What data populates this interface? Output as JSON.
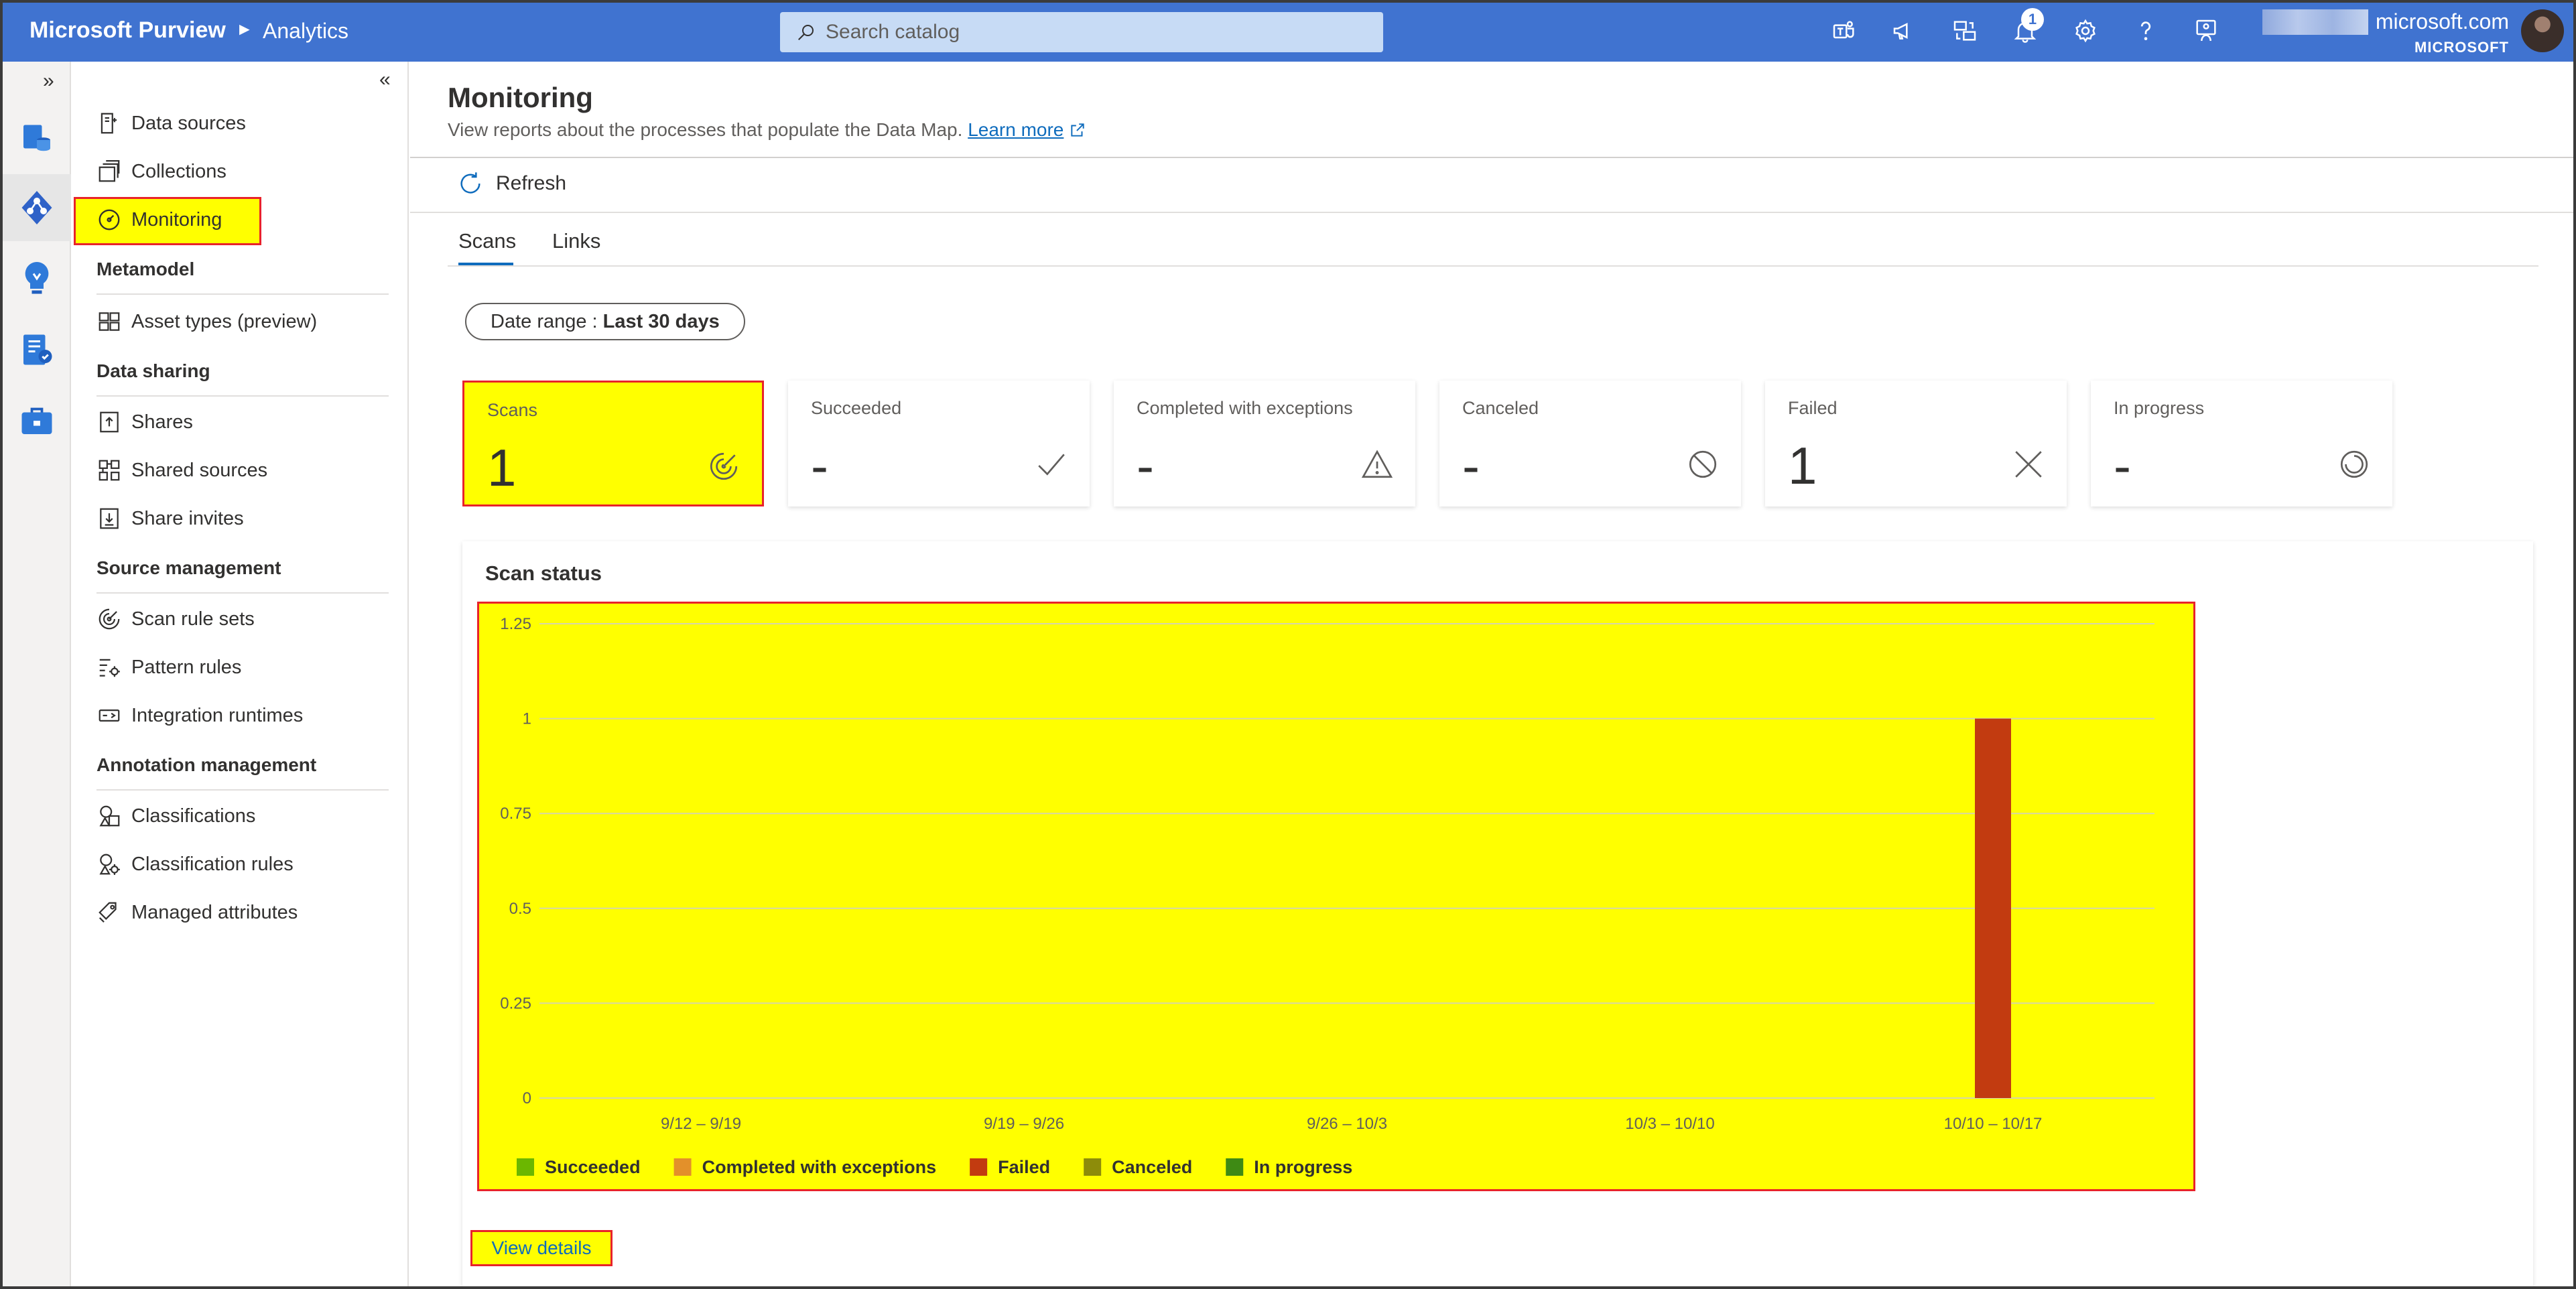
{
  "topbar": {
    "brand": "Microsoft Purview",
    "breadcrumb": "Analytics",
    "search_placeholder": "Search catalog",
    "notification_count": "1",
    "account_email": "microsoft.com",
    "account_org": "MICROSOFT"
  },
  "nav": {
    "items": [
      {
        "label": "Data sources",
        "icon": "data-sources-icon"
      },
      {
        "label": "Collections",
        "icon": "collections-icon"
      },
      {
        "label": "Monitoring",
        "icon": "monitoring-icon"
      }
    ],
    "sections": [
      {
        "title": "Metamodel",
        "items": [
          {
            "label": "Asset types (preview)",
            "icon": "asset-types-icon"
          }
        ]
      },
      {
        "title": "Data sharing",
        "items": [
          {
            "label": "Shares",
            "icon": "shares-icon"
          },
          {
            "label": "Shared sources",
            "icon": "shared-sources-icon"
          },
          {
            "label": "Share invites",
            "icon": "share-invites-icon"
          }
        ]
      },
      {
        "title": "Source management",
        "items": [
          {
            "label": "Scan rule sets",
            "icon": "scan-rule-sets-icon"
          },
          {
            "label": "Pattern rules",
            "icon": "pattern-rules-icon"
          },
          {
            "label": "Integration runtimes",
            "icon": "integration-runtimes-icon"
          }
        ]
      },
      {
        "title": "Annotation management",
        "items": [
          {
            "label": "Classifications",
            "icon": "classifications-icon"
          },
          {
            "label": "Classification rules",
            "icon": "classification-rules-icon"
          },
          {
            "label": "Managed attributes",
            "icon": "managed-attributes-icon"
          }
        ]
      }
    ]
  },
  "page": {
    "title": "Monitoring",
    "subtitle": "View reports about the processes that populate the Data Map.",
    "learn_more": "Learn more",
    "refresh": "Refresh",
    "tabs": [
      "Scans",
      "Links"
    ],
    "date_range_label": "Date range :",
    "date_range_value": "Last 30 days"
  },
  "cards": [
    {
      "label": "Scans",
      "value": "1",
      "icon": "scan-radar-icon"
    },
    {
      "label": "Succeeded",
      "value": "-",
      "icon": "checkmark-icon"
    },
    {
      "label": "Completed with exceptions",
      "value": "-",
      "icon": "warning-icon"
    },
    {
      "label": "Canceled",
      "value": "-",
      "icon": "blocked-icon"
    },
    {
      "label": "Failed",
      "value": "1",
      "icon": "x-icon"
    },
    {
      "label": "In progress",
      "value": "-",
      "icon": "progress-ring-icon"
    }
  ],
  "scan_status": {
    "title": "Scan status",
    "view_details": "View details"
  },
  "chart_data": {
    "type": "bar",
    "title": "Scan status",
    "categories": [
      "9/12 – 9/19",
      "9/19 – 9/26",
      "9/26 – 10/3",
      "10/3 – 10/10",
      "10/10 – 10/17"
    ],
    "series": [
      {
        "name": "Succeeded",
        "color": "#6bb700",
        "values": [
          0,
          0,
          0,
          0,
          0
        ]
      },
      {
        "name": "Completed with exceptions",
        "color": "#e3902a",
        "values": [
          0,
          0,
          0,
          0,
          0
        ]
      },
      {
        "name": "Failed",
        "color": "#c23b10",
        "values": [
          0,
          0,
          0,
          0,
          1
        ]
      },
      {
        "name": "Canceled",
        "color": "#8d8c0a",
        "values": [
          0,
          0,
          0,
          0,
          0
        ]
      },
      {
        "name": "In progress",
        "color": "#3e8a14",
        "values": [
          0,
          0,
          0,
          0,
          0
        ]
      }
    ],
    "yticks": [
      "1.25",
      "1",
      "0.75",
      "0.5",
      "0.25",
      "0"
    ],
    "ylim": [
      0,
      1.25
    ],
    "grid": true,
    "legend": "bottom-left"
  },
  "colors": {
    "topbar": "#4073d0",
    "highlight": "#ffff00",
    "highlight_border": "#e8232a",
    "link": "#0f6cbd"
  }
}
